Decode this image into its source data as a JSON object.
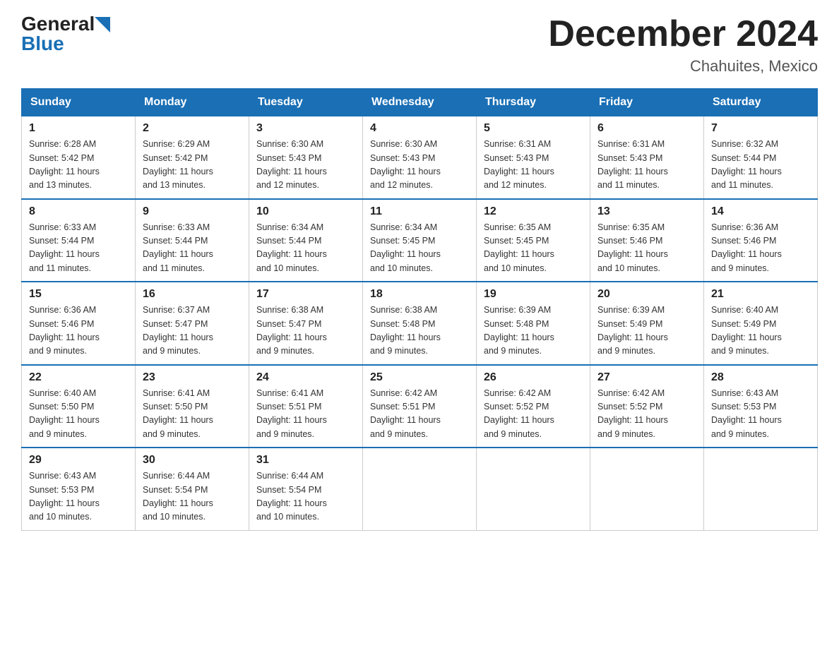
{
  "header": {
    "logo_general": "General",
    "logo_blue": "Blue",
    "title": "December 2024",
    "subtitle": "Chahuites, Mexico"
  },
  "weekdays": [
    "Sunday",
    "Monday",
    "Tuesday",
    "Wednesday",
    "Thursday",
    "Friday",
    "Saturday"
  ],
  "weeks": [
    [
      {
        "day": "1",
        "info": "Sunrise: 6:28 AM\nSunset: 5:42 PM\nDaylight: 11 hours\nand 13 minutes."
      },
      {
        "day": "2",
        "info": "Sunrise: 6:29 AM\nSunset: 5:42 PM\nDaylight: 11 hours\nand 13 minutes."
      },
      {
        "day": "3",
        "info": "Sunrise: 6:30 AM\nSunset: 5:43 PM\nDaylight: 11 hours\nand 12 minutes."
      },
      {
        "day": "4",
        "info": "Sunrise: 6:30 AM\nSunset: 5:43 PM\nDaylight: 11 hours\nand 12 minutes."
      },
      {
        "day": "5",
        "info": "Sunrise: 6:31 AM\nSunset: 5:43 PM\nDaylight: 11 hours\nand 12 minutes."
      },
      {
        "day": "6",
        "info": "Sunrise: 6:31 AM\nSunset: 5:43 PM\nDaylight: 11 hours\nand 11 minutes."
      },
      {
        "day": "7",
        "info": "Sunrise: 6:32 AM\nSunset: 5:44 PM\nDaylight: 11 hours\nand 11 minutes."
      }
    ],
    [
      {
        "day": "8",
        "info": "Sunrise: 6:33 AM\nSunset: 5:44 PM\nDaylight: 11 hours\nand 11 minutes."
      },
      {
        "day": "9",
        "info": "Sunrise: 6:33 AM\nSunset: 5:44 PM\nDaylight: 11 hours\nand 11 minutes."
      },
      {
        "day": "10",
        "info": "Sunrise: 6:34 AM\nSunset: 5:44 PM\nDaylight: 11 hours\nand 10 minutes."
      },
      {
        "day": "11",
        "info": "Sunrise: 6:34 AM\nSunset: 5:45 PM\nDaylight: 11 hours\nand 10 minutes."
      },
      {
        "day": "12",
        "info": "Sunrise: 6:35 AM\nSunset: 5:45 PM\nDaylight: 11 hours\nand 10 minutes."
      },
      {
        "day": "13",
        "info": "Sunrise: 6:35 AM\nSunset: 5:46 PM\nDaylight: 11 hours\nand 10 minutes."
      },
      {
        "day": "14",
        "info": "Sunrise: 6:36 AM\nSunset: 5:46 PM\nDaylight: 11 hours\nand 9 minutes."
      }
    ],
    [
      {
        "day": "15",
        "info": "Sunrise: 6:36 AM\nSunset: 5:46 PM\nDaylight: 11 hours\nand 9 minutes."
      },
      {
        "day": "16",
        "info": "Sunrise: 6:37 AM\nSunset: 5:47 PM\nDaylight: 11 hours\nand 9 minutes."
      },
      {
        "day": "17",
        "info": "Sunrise: 6:38 AM\nSunset: 5:47 PM\nDaylight: 11 hours\nand 9 minutes."
      },
      {
        "day": "18",
        "info": "Sunrise: 6:38 AM\nSunset: 5:48 PM\nDaylight: 11 hours\nand 9 minutes."
      },
      {
        "day": "19",
        "info": "Sunrise: 6:39 AM\nSunset: 5:48 PM\nDaylight: 11 hours\nand 9 minutes."
      },
      {
        "day": "20",
        "info": "Sunrise: 6:39 AM\nSunset: 5:49 PM\nDaylight: 11 hours\nand 9 minutes."
      },
      {
        "day": "21",
        "info": "Sunrise: 6:40 AM\nSunset: 5:49 PM\nDaylight: 11 hours\nand 9 minutes."
      }
    ],
    [
      {
        "day": "22",
        "info": "Sunrise: 6:40 AM\nSunset: 5:50 PM\nDaylight: 11 hours\nand 9 minutes."
      },
      {
        "day": "23",
        "info": "Sunrise: 6:41 AM\nSunset: 5:50 PM\nDaylight: 11 hours\nand 9 minutes."
      },
      {
        "day": "24",
        "info": "Sunrise: 6:41 AM\nSunset: 5:51 PM\nDaylight: 11 hours\nand 9 minutes."
      },
      {
        "day": "25",
        "info": "Sunrise: 6:42 AM\nSunset: 5:51 PM\nDaylight: 11 hours\nand 9 minutes."
      },
      {
        "day": "26",
        "info": "Sunrise: 6:42 AM\nSunset: 5:52 PM\nDaylight: 11 hours\nand 9 minutes."
      },
      {
        "day": "27",
        "info": "Sunrise: 6:42 AM\nSunset: 5:52 PM\nDaylight: 11 hours\nand 9 minutes."
      },
      {
        "day": "28",
        "info": "Sunrise: 6:43 AM\nSunset: 5:53 PM\nDaylight: 11 hours\nand 9 minutes."
      }
    ],
    [
      {
        "day": "29",
        "info": "Sunrise: 6:43 AM\nSunset: 5:53 PM\nDaylight: 11 hours\nand 10 minutes."
      },
      {
        "day": "30",
        "info": "Sunrise: 6:44 AM\nSunset: 5:54 PM\nDaylight: 11 hours\nand 10 minutes."
      },
      {
        "day": "31",
        "info": "Sunrise: 6:44 AM\nSunset: 5:54 PM\nDaylight: 11 hours\nand 10 minutes."
      },
      {
        "day": "",
        "info": ""
      },
      {
        "day": "",
        "info": ""
      },
      {
        "day": "",
        "info": ""
      },
      {
        "day": "",
        "info": ""
      }
    ]
  ]
}
